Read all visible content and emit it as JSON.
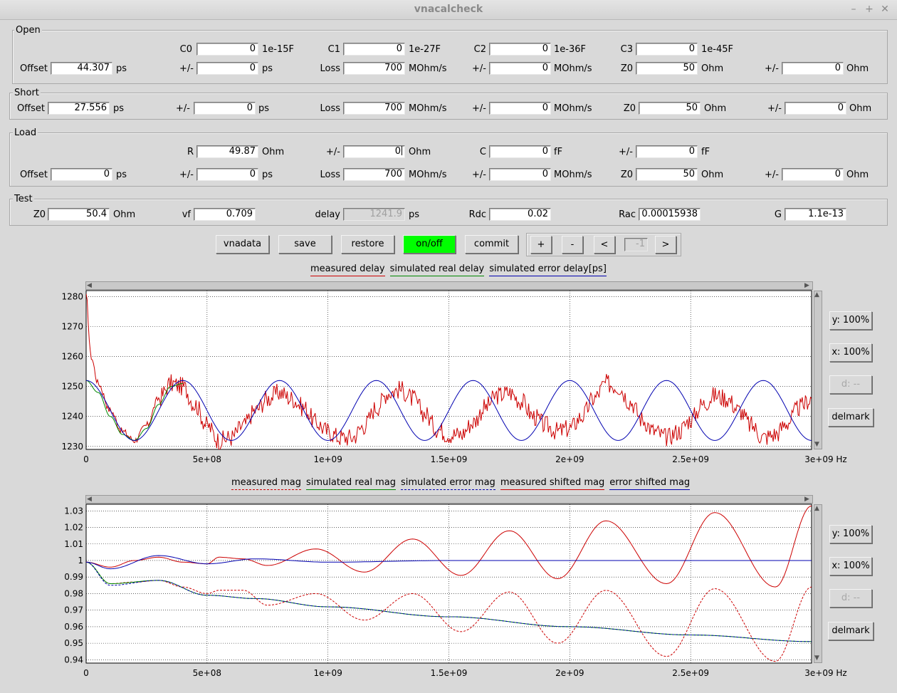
{
  "window": {
    "title": "vnacalcheck"
  },
  "open": {
    "label": "Open",
    "c0_label": "C0",
    "c0": "0",
    "c0_unit": "1e-15F",
    "c1_label": "C1",
    "c1": "0",
    "c1_unit": "1e-27F",
    "c2_label": "C2",
    "c2": "0",
    "c2_unit": "1e-36F",
    "c3_label": "C3",
    "c3": "0",
    "c3_unit": "1e-45F",
    "offset_label": "Offset",
    "offset": "44.307",
    "offset_unit": "ps",
    "pm1_label": "+/-",
    "pm1": "0",
    "pm1_unit": "ps",
    "loss_label": "Loss",
    "loss": "700",
    "loss_unit": "MOhm/s",
    "pm2_label": "+/-",
    "pm2": "0",
    "pm2_unit": "MOhm/s",
    "z0_label": "Z0",
    "z0": "50",
    "z0_unit": "Ohm",
    "pm3_label": "+/-",
    "pm3": "0",
    "pm3_unit": "Ohm"
  },
  "short": {
    "label": "Short",
    "offset_label": "Offset",
    "offset": "27.556",
    "offset_unit": "ps",
    "pm1_label": "+/-",
    "pm1": "0",
    "pm1_unit": "ps",
    "loss_label": "Loss",
    "loss": "700",
    "loss_unit": "MOhm/s",
    "pm2_label": "+/-",
    "pm2": "0",
    "pm2_unit": "MOhm/s",
    "z0_label": "Z0",
    "z0": "50",
    "z0_unit": "Ohm",
    "pm3_label": "+/-",
    "pm3": "0",
    "pm3_unit": "Ohm"
  },
  "load": {
    "label": "Load",
    "r_label": "R",
    "r": "49.87",
    "r_unit": "Ohm",
    "pmr_label": "+/-",
    "pmr": "0",
    "pmr_unit": "Ohm",
    "c_label": "C",
    "c": "0",
    "c_unit": "fF",
    "pmc_label": "+/-",
    "pmc": "0",
    "pmc_unit": "fF",
    "offset_label": "Offset",
    "offset": "0",
    "offset_unit": "ps",
    "pm1_label": "+/-",
    "pm1": "0",
    "pm1_unit": "ps",
    "loss_label": "Loss",
    "loss": "700",
    "loss_unit": "MOhm/s",
    "pm2_label": "+/-",
    "pm2": "0",
    "pm2_unit": "MOhm/s",
    "z0_label": "Z0",
    "z0": "50",
    "z0_unit": "Ohm",
    "pm3_label": "+/-",
    "pm3": "0",
    "pm3_unit": "Ohm"
  },
  "test": {
    "label": "Test",
    "z0_label": "Z0",
    "z0": "50.4",
    "z0_unit": "Ohm",
    "vf_label": "vf",
    "vf": "0.709",
    "delay_label": "delay",
    "delay": "1241.9",
    "delay_unit": "ps",
    "rdc_label": "Rdc",
    "rdc": "0.02",
    "rac_label": "Rac",
    "rac": "0.00015938",
    "g_label": "G",
    "g": "1.1e-13"
  },
  "toolbar": {
    "vnadata": "vnadata",
    "save": "save",
    "restore": "restore",
    "onoff": "on/off",
    "commit": "commit",
    "plus": "+",
    "minus": "-",
    "prev": "<",
    "index": "-1",
    "next": ">"
  },
  "delay_legend": {
    "measured": "measured delay",
    "sim_real": "simulated real delay",
    "sim_error": "simulated error delay[ps]"
  },
  "mag_legend": {
    "measured": "measured mag",
    "sim_real": "simulated real mag",
    "sim_error": "simulated error mag",
    "measured_shifted": "measured shifted mag",
    "error_shifted": "error shifted mag"
  },
  "side1": {
    "y": "y: 100%",
    "x": "x: 100%",
    "d": "d: --",
    "delmark": "delmark"
  },
  "side2": {
    "y": "y: 100%",
    "x": "x: 100%",
    "d": "d: --",
    "delmark": "delmark"
  },
  "colors": {
    "red": "#cc0000",
    "green": "#008800",
    "blue": "#0000b0",
    "onoff_bg": "#00ff00"
  },
  "chart_data": [
    {
      "type": "line",
      "title": "",
      "xlabel": "Hz",
      "ylabel": "",
      "xlim": [
        0,
        3000000000
      ],
      "ylim": [
        1229,
        1282
      ],
      "x_ticks": [
        0,
        500000000,
        1000000000,
        1500000000,
        2000000000,
        2500000000,
        3000000000
      ],
      "x_tick_labels": [
        "0",
        "5e+08",
        "1e+09",
        "1.5e+09",
        "2e+09",
        "2.5e+09",
        "3e+09 Hz"
      ],
      "y_ticks": [
        1230,
        1240,
        1250,
        1260,
        1270,
        1280
      ],
      "y_tick_labels": [
        "1230",
        "1240",
        "1250",
        "1260",
        "1270",
        "1280"
      ],
      "grid": true,
      "series": [
        {
          "name": "measured delay",
          "color": "#cc0000",
          "x": [
            0,
            20000000,
            50000000,
            100000000,
            150000000,
            200000000,
            250000000,
            300000000,
            350000000,
            400000000,
            450000000,
            500000000,
            550000000,
            600000000,
            650000000,
            700000000,
            750000000,
            800000000,
            850000000,
            900000000,
            950000000,
            1000000000,
            1050000000,
            1100000000,
            1150000000,
            1200000000,
            1250000000,
            1300000000,
            1350000000,
            1400000000,
            1450000000,
            1500000000,
            1550000000,
            1600000000,
            1650000000,
            1700000000,
            1750000000,
            1800000000,
            1850000000,
            1900000000,
            1950000000,
            2000000000,
            2050000000,
            2100000000,
            2150000000,
            2200000000,
            2250000000,
            2300000000,
            2350000000,
            2400000000,
            2450000000,
            2500000000,
            2550000000,
            2600000000,
            2650000000,
            2700000000,
            2750000000,
            2800000000,
            2850000000,
            2900000000,
            2950000000,
            3000000000
          ],
          "y": [
            1280,
            1260,
            1251,
            1242,
            1235,
            1232,
            1237,
            1246,
            1251,
            1250,
            1244,
            1237,
            1232,
            1233,
            1237,
            1242,
            1246,
            1248,
            1246,
            1243,
            1238,
            1235,
            1233,
            1233,
            1237,
            1243,
            1248,
            1249,
            1246,
            1241,
            1236,
            1234,
            1234,
            1238,
            1243,
            1247,
            1248,
            1245,
            1240,
            1237,
            1235,
            1236,
            1240,
            1246,
            1251,
            1250,
            1245,
            1239,
            1235,
            1233,
            1235,
            1239,
            1244,
            1247,
            1246,
            1242,
            1237,
            1233,
            1234,
            1238,
            1243,
            1246
          ]
        },
        {
          "name": "simulated real delay",
          "color": "#008800",
          "x": [
            0,
            50000000,
            100000000,
            150000000,
            200000000,
            250000000,
            300000000,
            350000000,
            400000000
          ],
          "y": [
            1252,
            1248,
            1240,
            1234,
            1232,
            1236,
            1244,
            1250,
            1251
          ]
        },
        {
          "name": "simulated error delay[ps]",
          "color": "#0000b0",
          "shape": "sine",
          "center": 1242,
          "amplitude": 10,
          "period": 400000000,
          "phase_peak_at": 0,
          "x": [
            0,
            100000000,
            200000000,
            300000000,
            400000000,
            500000000,
            600000000,
            700000000,
            800000000,
            900000000,
            1000000000,
            1100000000,
            1200000000,
            1300000000,
            1400000000,
            1500000000,
            1600000000,
            1700000000,
            1800000000,
            1900000000,
            2000000000,
            2100000000,
            2200000000,
            2300000000,
            2400000000,
            2500000000,
            2600000000,
            2700000000,
            2800000000,
            2900000000,
            3000000000
          ],
          "y": [
            1252,
            1242,
            1232,
            1242,
            1252,
            1242,
            1232,
            1242,
            1252,
            1242,
            1232,
            1242,
            1252,
            1242,
            1232,
            1242,
            1252,
            1242,
            1232,
            1242,
            1252,
            1242,
            1232,
            1242,
            1252,
            1242,
            1232,
            1242,
            1252,
            1242,
            1232
          ]
        }
      ]
    },
    {
      "type": "line",
      "title": "",
      "xlabel": "Hz",
      "ylabel": "",
      "xlim": [
        0,
        3000000000
      ],
      "ylim": [
        0.938,
        1.034
      ],
      "x_ticks": [
        0,
        500000000,
        1000000000,
        1500000000,
        2000000000,
        2500000000,
        3000000000
      ],
      "x_tick_labels": [
        "0",
        "5e+08",
        "1e+09",
        "1.5e+09",
        "2e+09",
        "2.5e+09",
        "3e+09 Hz"
      ],
      "y_ticks": [
        0.94,
        0.95,
        0.96,
        0.97,
        0.98,
        0.99,
        1,
        1.01,
        1.02,
        1.03
      ],
      "y_tick_labels": [
        "0.94",
        "0.95",
        "0.96",
        "0.97",
        "0.98",
        "0.99",
        "1",
        "1.01",
        "1.02",
        "1.03"
      ],
      "grid": true,
      "series": [
        {
          "name": "measured mag",
          "color": "#cc0000",
          "dashed": true,
          "x": [
            0,
            100000000,
            200000000,
            300000000,
            400000000,
            500000000,
            550000000,
            650000000,
            750000000,
            950000000,
            1150000000,
            1350000000,
            1550000000,
            1750000000,
            1950000000,
            2150000000,
            2400000000,
            2600000000,
            2850000000,
            3000000000
          ],
          "y": [
            0.999,
            0.986,
            0.987,
            0.988,
            0.984,
            0.98,
            0.982,
            0.982,
            0.973,
            0.98,
            0.964,
            0.98,
            0.957,
            0.981,
            0.95,
            0.982,
            0.942,
            0.983,
            0.939,
            0.984
          ]
        },
        {
          "name": "simulated real mag",
          "color": "#008800",
          "x": [
            0,
            100000000,
            300000000,
            500000000,
            700000000,
            1000000000,
            1500000000,
            2000000000,
            2500000000,
            3000000000
          ],
          "y": [
            0.999,
            0.986,
            0.988,
            0.979,
            0.977,
            0.972,
            0.966,
            0.96,
            0.955,
            0.951
          ]
        },
        {
          "name": "simulated error mag",
          "color": "#0000b0",
          "dashed": true,
          "x": [
            0,
            100000000,
            300000000,
            500000000,
            700000000,
            1000000000,
            1500000000,
            2000000000,
            2500000000,
            3000000000
          ],
          "y": [
            0.999,
            0.985,
            0.988,
            0.979,
            0.977,
            0.972,
            0.966,
            0.96,
            0.955,
            0.951
          ]
        },
        {
          "name": "measured shifted mag",
          "color": "#cc0000",
          "x": [
            0,
            100000000,
            200000000,
            300000000,
            400000000,
            500000000,
            550000000,
            650000000,
            750000000,
            950000000,
            1150000000,
            1350000000,
            1550000000,
            1750000000,
            1950000000,
            2150000000,
            2400000000,
            2600000000,
            2850000000,
            3000000000
          ],
          "y": [
            0.999,
            0.996,
            1.0,
            1.002,
            0.999,
            0.998,
            1.002,
            1.001,
            0.997,
            1.007,
            0.993,
            1.013,
            0.991,
            1.018,
            0.989,
            1.024,
            0.986,
            1.029,
            0.984,
            1.033
          ]
        },
        {
          "name": "error shifted mag",
          "color": "#0000b0",
          "x": [
            0,
            100000000,
            300000000,
            500000000,
            700000000,
            1000000000,
            1500000000,
            2000000000,
            2500000000,
            3000000000
          ],
          "y": [
            0.999,
            0.995,
            1.003,
            0.998,
            1.001,
            0.999,
            1.0,
            1.0,
            1.0,
            1.0
          ]
        }
      ]
    }
  ]
}
